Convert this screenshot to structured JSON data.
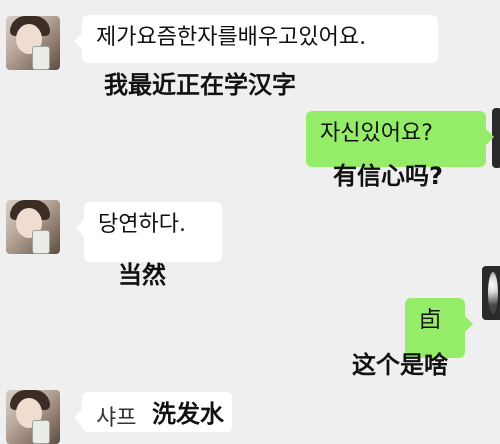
{
  "messages": [
    {
      "side": "left",
      "text": "제가요즘한자를배우고있어요.",
      "caption": "我最近正在学汉字",
      "avatar": "avatar-girl"
    },
    {
      "side": "right",
      "text": "자신있어요?",
      "caption": "有信心吗?",
      "avatar": "avatar-dark"
    },
    {
      "side": "left",
      "text": "당연하다.",
      "caption": "当然",
      "avatar": "avatar-girl"
    },
    {
      "side": "right",
      "text": "卣",
      "caption": "这个是啥",
      "avatar": "avatar-dark"
    },
    {
      "side": "left",
      "text": "샤프",
      "caption": "洗发水",
      "avatar": "avatar-girl"
    }
  ],
  "colors": {
    "background": "#efefef",
    "left_bubble": "#ffffff",
    "right_bubble": "#95ec69"
  }
}
